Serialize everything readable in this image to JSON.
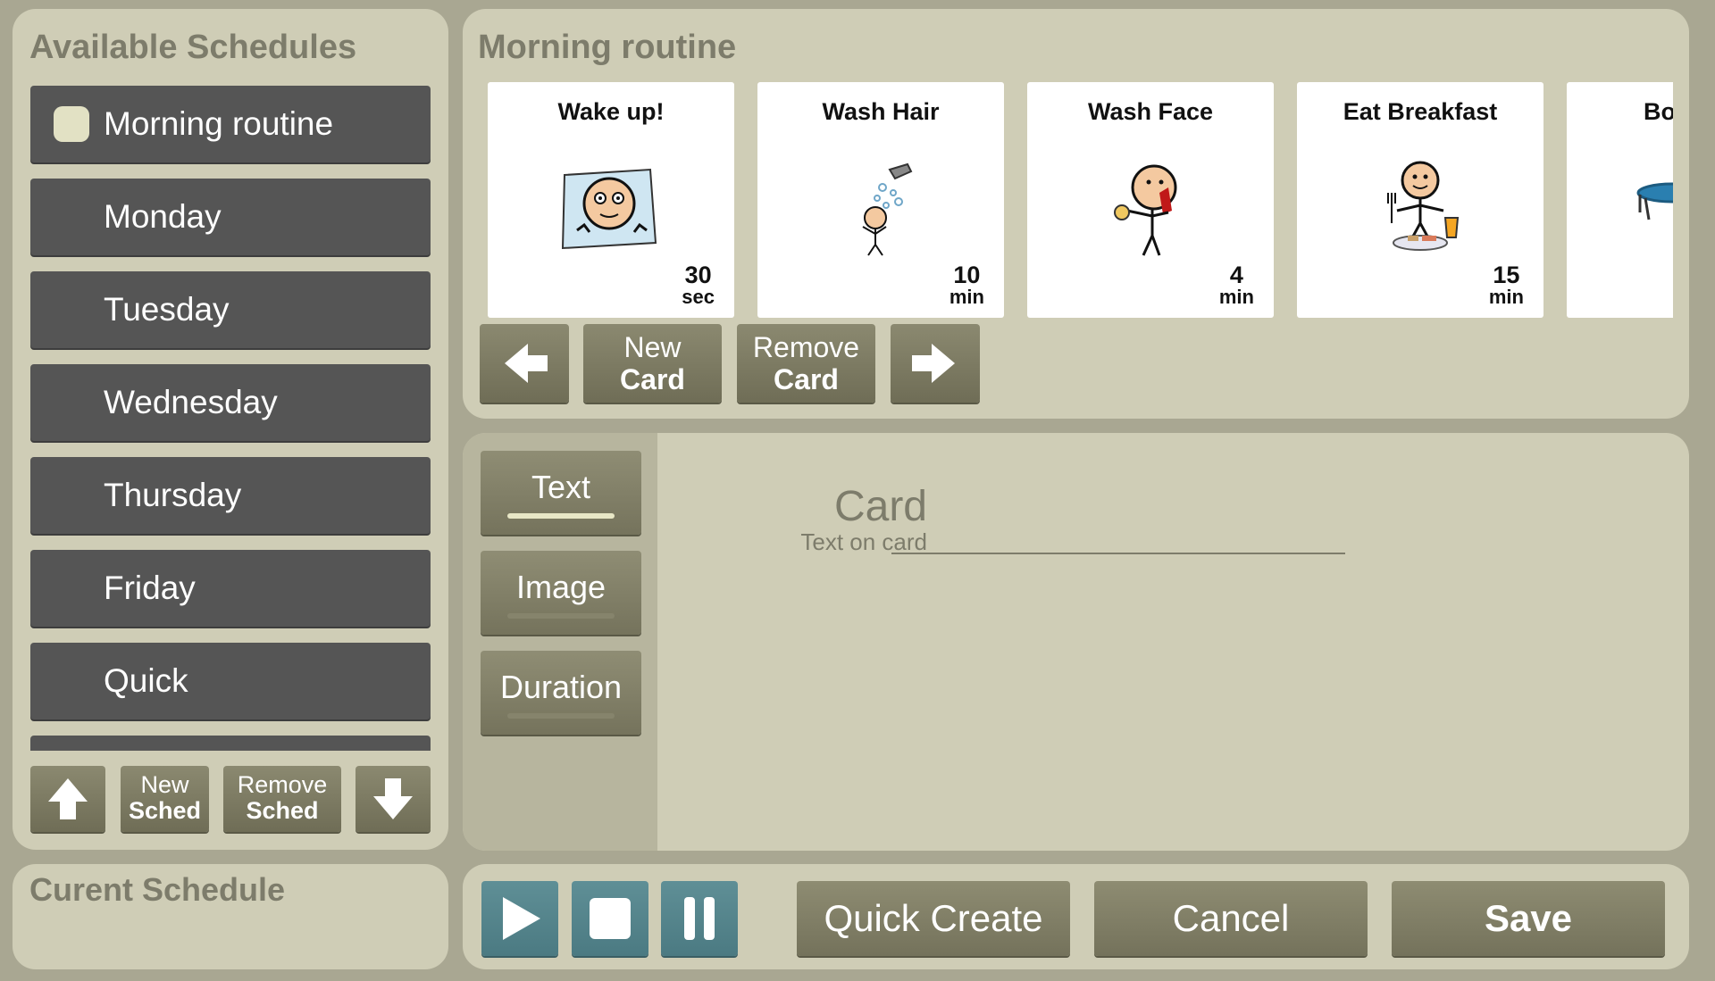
{
  "left_panel": {
    "title": "Available Schedules",
    "schedules": [
      "Morning routine",
      "Monday",
      "Tuesday",
      "Wednesday",
      "Thursday",
      "Friday",
      "Quick"
    ],
    "selected_index": 0,
    "buttons": {
      "up_icon": "arrow-up-icon",
      "new_line1": "New",
      "new_line2": "Sched",
      "remove_line1": "Remove",
      "remove_line2": "Sched",
      "down_icon": "arrow-down-icon"
    }
  },
  "current_panel": {
    "title": "Curent Schedule"
  },
  "schedule": {
    "title": "Morning routine",
    "cards": [
      {
        "label": "Wake up!",
        "duration": "30",
        "unit": "sec",
        "icon": "wake-up-icon"
      },
      {
        "label": "Wash Hair",
        "duration": "10",
        "unit": "min",
        "icon": "wash-hair-icon"
      },
      {
        "label": "Wash Face",
        "duration": "4",
        "unit": "min",
        "icon": "wash-face-icon"
      },
      {
        "label": "Eat Breakfast",
        "duration": "15",
        "unit": "min",
        "icon": "eat-breakfast-icon"
      },
      {
        "label": "Bo",
        "icon": "trampoline-icon"
      }
    ],
    "buttons": {
      "prev_icon": "arrow-left-icon",
      "new_line1": "New",
      "new_line2": "Card",
      "remove_line1": "Remove",
      "remove_line2": "Card",
      "next_icon": "arrow-right-icon"
    }
  },
  "editor": {
    "tabs": [
      "Text",
      "Image",
      "Duration"
    ],
    "active_tab": "Text",
    "field_title": "Card",
    "field_subtitle": "Text on card",
    "field_value": ""
  },
  "controls": {
    "play_icon": "play-icon",
    "stop_icon": "stop-icon",
    "pause_icon": "pause-icon",
    "quick_create": "Quick Create",
    "cancel": "Cancel",
    "save": "Save"
  },
  "colors": {
    "background": "#a9a792",
    "panel": "#cfcdb6",
    "schedule_item": "#555555",
    "button": "#7f7d65",
    "media_button": "#557f86",
    "card": "#ffffff"
  }
}
